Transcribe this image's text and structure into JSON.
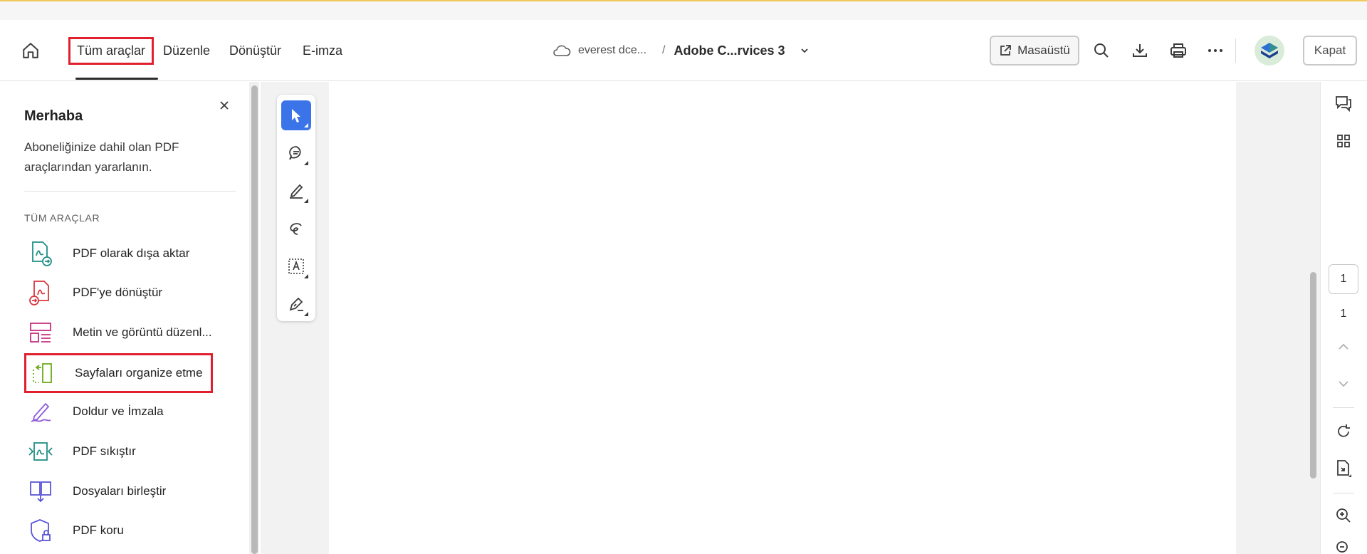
{
  "header": {
    "nav_tabs": [
      {
        "label": "Tüm araçlar",
        "active": true
      },
      {
        "label": "Düzenle"
      },
      {
        "label": "Dönüştür"
      },
      {
        "label": "E-imza"
      }
    ],
    "breadcrumb": {
      "folder": "everest dce...",
      "separator": "/",
      "document": "Adobe C...rvices 3"
    },
    "desktop_button": "Masaüstü",
    "close_button": "Kapat",
    "icons": [
      "home-icon",
      "cloud-icon",
      "chevron-down-icon",
      "external-link-icon",
      "search-icon",
      "download-icon",
      "print-icon",
      "more-icon",
      "avatar"
    ]
  },
  "sidebar": {
    "title": "Merhaba",
    "description": "Aboneliğinize dahil olan PDF araçlarından yararlanın.",
    "section_label": "TÜM ARAÇLAR",
    "tools": [
      {
        "label": "PDF olarak dışa aktar",
        "icon": "export-pdf-icon",
        "color": "#1f8f86"
      },
      {
        "label": "PDF'ye dönüştür",
        "icon": "convert-pdf-icon",
        "color": "#d7373f"
      },
      {
        "label": "Metin ve görüntü düzenl...",
        "icon": "edit-text-image-icon",
        "color": "#c7307e"
      },
      {
        "label": "Sayfaları organize etme",
        "icon": "organize-pages-icon",
        "color": "#6bab1c"
      },
      {
        "label": "Doldur ve İmzala",
        "icon": "fill-sign-icon",
        "color": "#8e5cd9"
      },
      {
        "label": "PDF sıkıştır",
        "icon": "compress-pdf-icon",
        "color": "#1f8f86"
      },
      {
        "label": "Dosyaları birleştir",
        "icon": "combine-files-icon",
        "color": "#5a56d6"
      },
      {
        "label": "PDF koru",
        "icon": "protect-pdf-icon",
        "color": "#5a56d6"
      }
    ]
  },
  "toolbar": {
    "tools": [
      "select-icon",
      "comment-icon",
      "highlight-icon",
      "draw-icon",
      "text-select-icon",
      "sign-icon"
    ],
    "accent": "#3b73e9"
  },
  "right_rail": {
    "current_page": "1",
    "total_pages": "1",
    "icons": [
      "comments-icon",
      "thumbnails-icon",
      "page-up-icon",
      "page-down-icon",
      "rotate-icon",
      "page-extract-icon",
      "zoom-in-icon"
    ]
  },
  "colors": {
    "highlight_box": "#e0202e",
    "top_accent": "#f0c95a"
  }
}
